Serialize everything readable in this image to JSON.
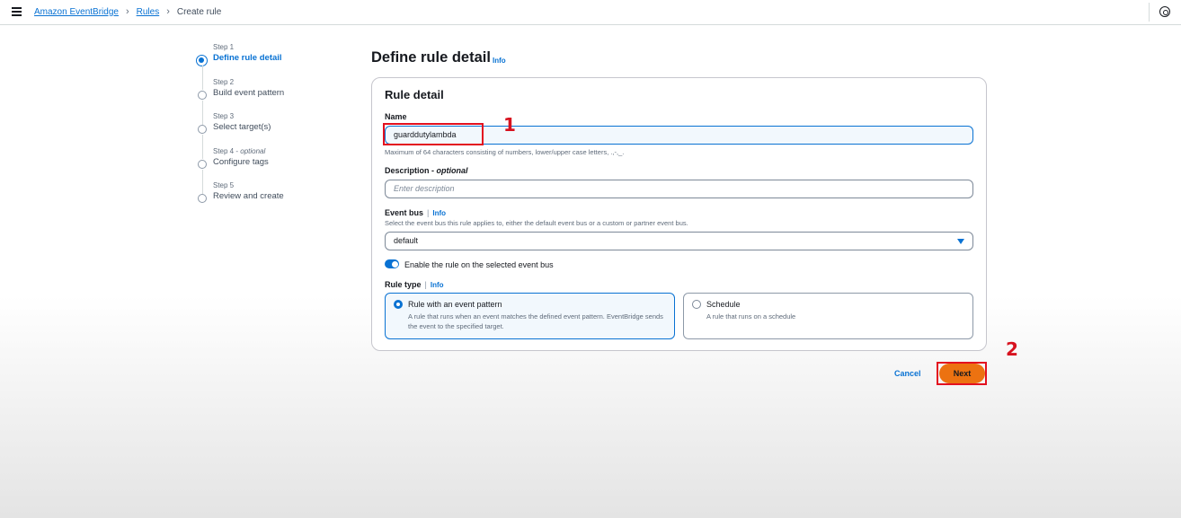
{
  "breadcrumb": {
    "items": [
      "Amazon EventBridge",
      "Rules"
    ],
    "current": "Create rule"
  },
  "steps": [
    {
      "sub": "Step 1",
      "title": "Define rule detail"
    },
    {
      "sub": "Step 2",
      "title": "Build event pattern"
    },
    {
      "sub": "Step 3",
      "title": "Select target(s)"
    },
    {
      "sub": "Step 4",
      "sub_optional": "optional",
      "title": "Configure tags"
    },
    {
      "sub": "Step 5",
      "title": "Review and create"
    }
  ],
  "page": {
    "title": "Define rule detail",
    "info": "Info"
  },
  "rule_detail": {
    "title": "Rule detail",
    "name_label": "Name",
    "name_value": "guarddutylambda",
    "name_hint": "Maximum of 64 characters consisting of numbers, lower/upper case letters, .,-,_.",
    "description_label": "Description",
    "description_optional": "optional",
    "description_placeholder": "Enter description",
    "event_bus_label": "Event bus",
    "event_bus_info": "Info",
    "event_bus_hint": "Select the event bus this rule applies to, either the default event bus or a custom or partner event bus.",
    "event_bus_value": "default",
    "enable_label": "Enable the rule on the selected event bus",
    "rule_type_label": "Rule type",
    "rule_type_info": "Info",
    "rule_types": [
      {
        "title": "Rule with an event pattern",
        "desc": "A rule that runs when an event matches the defined event pattern. EventBridge sends the event to the specified target.",
        "selected": true
      },
      {
        "title": "Schedule",
        "desc": "A rule that runs on a schedule",
        "selected": false
      }
    ]
  },
  "actions": {
    "cancel": "Cancel",
    "next": "Next"
  },
  "annotations": [
    "1",
    "2"
  ],
  "colors": {
    "accent": "#0972d3",
    "primary_button": "#ec7211",
    "annotation": "#e3111f"
  }
}
